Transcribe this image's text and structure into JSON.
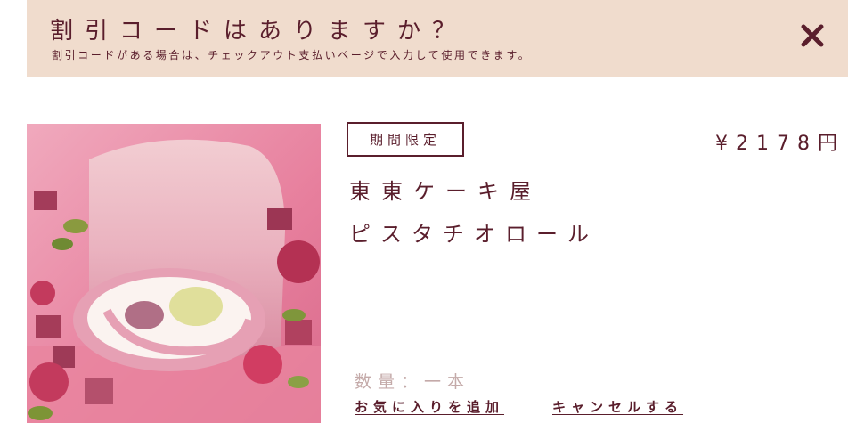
{
  "banner": {
    "title": "割引コードはありますか？",
    "subtitle": "割引コードがある場合は、チェックアウト支払いページで入力して使用できます。"
  },
  "close_icon": "close-icon",
  "product": {
    "badge": "期間限定",
    "price": "¥2178円",
    "brand": "東東ケーキ屋",
    "name": "ピスタチオロール",
    "quantity": "数量：一本",
    "add_favorite": "お気に入りを追加",
    "cancel": "キャンセルする",
    "image_icon": "cake-roll-photo"
  },
  "colors": {
    "accent": "#5a1e2c",
    "banner_bg": "#f0dccd",
    "muted_text": "#c4aaa9",
    "image_bg": "#e68aa4"
  }
}
